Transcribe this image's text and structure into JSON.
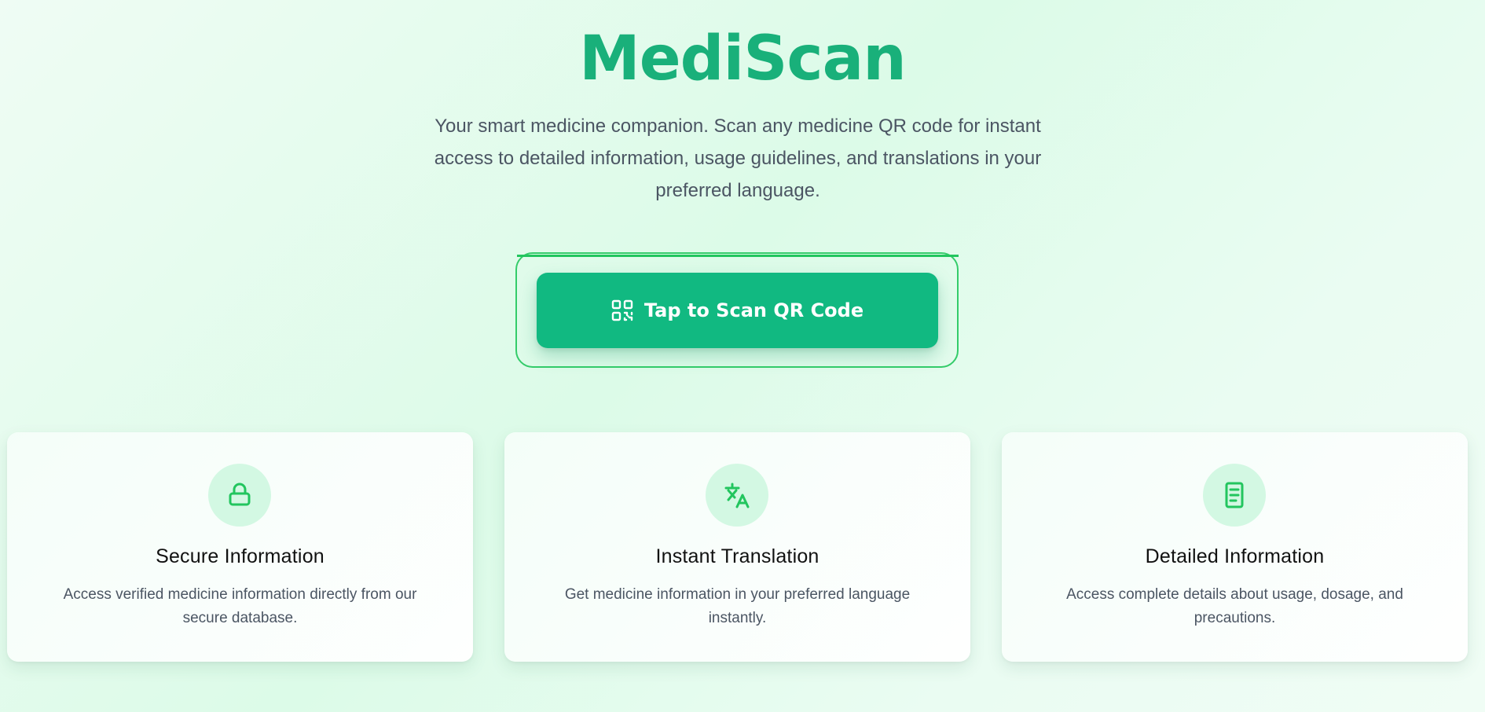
{
  "hero": {
    "title": "MediScan",
    "subtitle": "Your smart medicine companion. Scan any medicine QR code for instant access to detailed information, usage guidelines, and translations in your preferred language."
  },
  "scan": {
    "button_label": "Tap to Scan QR Code",
    "icon": "qr-code-icon"
  },
  "features": [
    {
      "icon": "lock-icon",
      "title": "Secure Information",
      "description": "Access verified medicine information directly from our secure database."
    },
    {
      "icon": "translate-icon",
      "title": "Instant Translation",
      "description": "Get medicine information in your preferred language instantly."
    },
    {
      "icon": "document-icon",
      "title": "Detailed Information",
      "description": "Access complete details about usage, dosage, and precautions."
    }
  ],
  "colors": {
    "brand": "#19b07a",
    "button": "#11b981",
    "accent_icon": "#22c55e",
    "icon_bg": "#d3f8e3",
    "ring": "#34cc6a"
  }
}
